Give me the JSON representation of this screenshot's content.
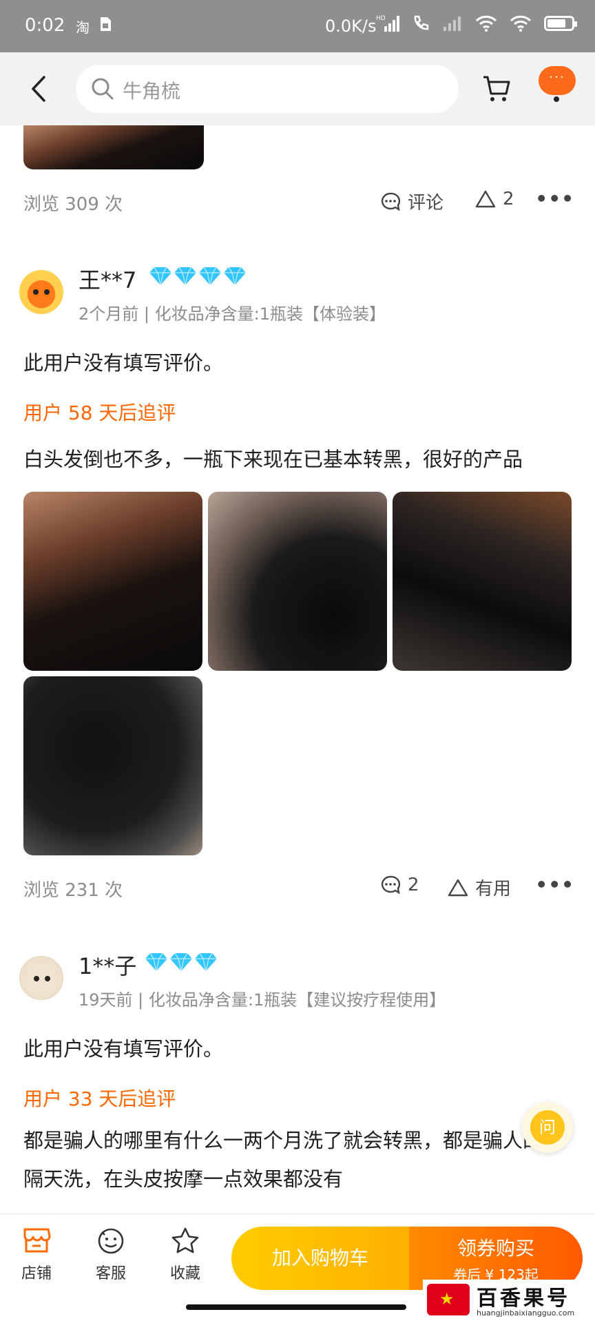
{
  "status_bar": {
    "time": "0:02",
    "left_icons": [
      "淘",
      "sim-card-icon"
    ],
    "network_speed": "0.0K/s",
    "hd_label": "HD",
    "battery_level": 0.75
  },
  "top_bar": {
    "search_placeholder": "牛角梳",
    "more_glyph": "···"
  },
  "review_prev": {
    "views": "浏览 309 次",
    "comment_label": "评论",
    "like_count": "2",
    "more_glyph": "•••"
  },
  "review_1": {
    "username": "王**7",
    "diamond_count": 4,
    "subline": "2个月前 | 化妆品净含量:1瓶装【体验装】",
    "text": "此用户没有填写评价。",
    "followup_label": "用户 58 天后追评",
    "followup_text": "白头发倒也不多，一瓶下来现在已基本转黑，很好的产品",
    "views": "浏览 231 次",
    "comment_count": "2",
    "useful_label": "有用",
    "more_glyph": "•••"
  },
  "review_2": {
    "username": "1**子",
    "diamond_count": 3,
    "subline": "19天前 | 化妆品净含量:1瓶装【建议按疗程使用】",
    "text": "此用户没有填写评价。",
    "followup_label": "用户 33 天后追评",
    "followup_text": "都是骗人的哪里有什么一两个月洗了就会转黑，都是骗人的，隔天洗，在头皮按摩一点效果都没有"
  },
  "ask_fab": {
    "label": "问"
  },
  "bottom_bar": {
    "store_label": "店铺",
    "service_label": "客服",
    "favorite_label": "收藏",
    "add_to_cart_label": "加入购物车",
    "coupon_buy_label": "领券购买",
    "coupon_price": "券后 ¥ 123起"
  },
  "colors": {
    "accent_orange": "#ff6600",
    "diamond_blue": "#32c5ff",
    "cta_yellow": "#ffc400",
    "cta_orange": "#ff6a00"
  },
  "watermark": {
    "title": "百香果号",
    "url": "huangjinbaixiangguo.com"
  }
}
